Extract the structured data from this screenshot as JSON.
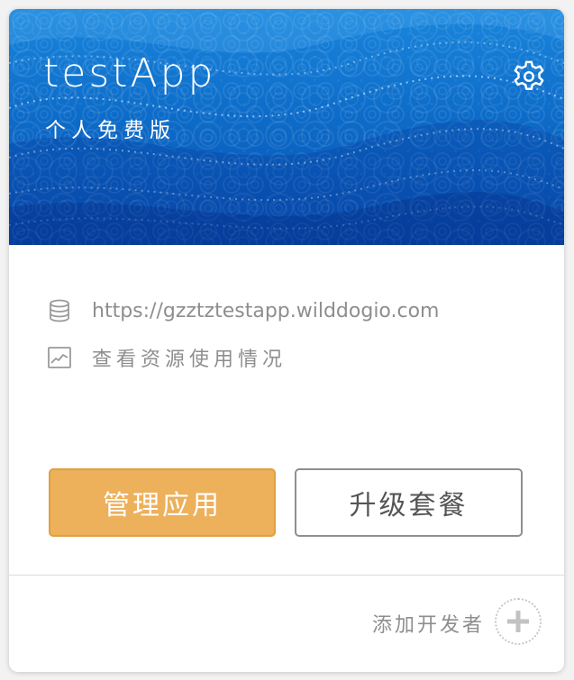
{
  "app": {
    "name": "testApp",
    "plan": "个人免费版"
  },
  "info": {
    "url": "https://gzztztestapp.wilddogio.com",
    "usage_link": "查看资源使用情况"
  },
  "buttons": {
    "manage": "管理应用",
    "upgrade": "升级套餐"
  },
  "footer": {
    "add_developer": "添加开发者"
  },
  "icons": {
    "settings": "gear-icon",
    "database": "database-icon",
    "chart": "line-chart-icon",
    "add": "plus-icon"
  },
  "colors": {
    "banner_top": "#1a86dc",
    "banner_bottom": "#0a4fb0",
    "manage_button": "#edb05b",
    "muted_text": "#8e8e8e"
  }
}
